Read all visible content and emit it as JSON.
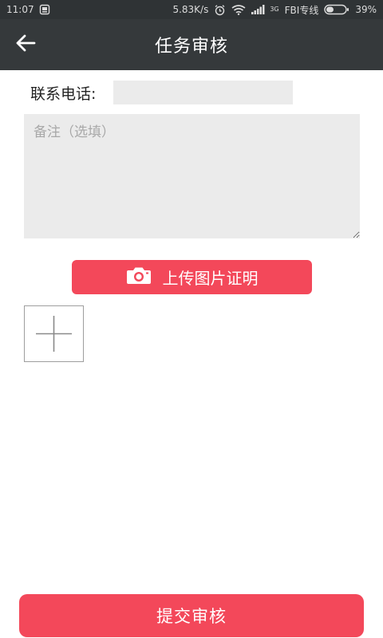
{
  "status_bar": {
    "time": "11:07",
    "speed": "5.83K/s",
    "network_tag": "3G",
    "carrier": "FBI专线",
    "battery": "39%",
    "battery_level": 0.39
  },
  "app_bar": {
    "title": "任务审核"
  },
  "form": {
    "phone_label": "联系电话:",
    "phone_value": "",
    "remark_placeholder": "备注（选填）",
    "remark_value": ""
  },
  "upload": {
    "label": "上传图片证明"
  },
  "submit": {
    "label": "提交审核"
  },
  "colors": {
    "accent": "#f3485a",
    "app_bar": "#35393b",
    "status_bar": "#2f3335",
    "field_bg": "#ebebeb"
  },
  "icons": {
    "back": "arrow-left-icon",
    "upload": "camera-icon",
    "add": "plus-icon"
  }
}
